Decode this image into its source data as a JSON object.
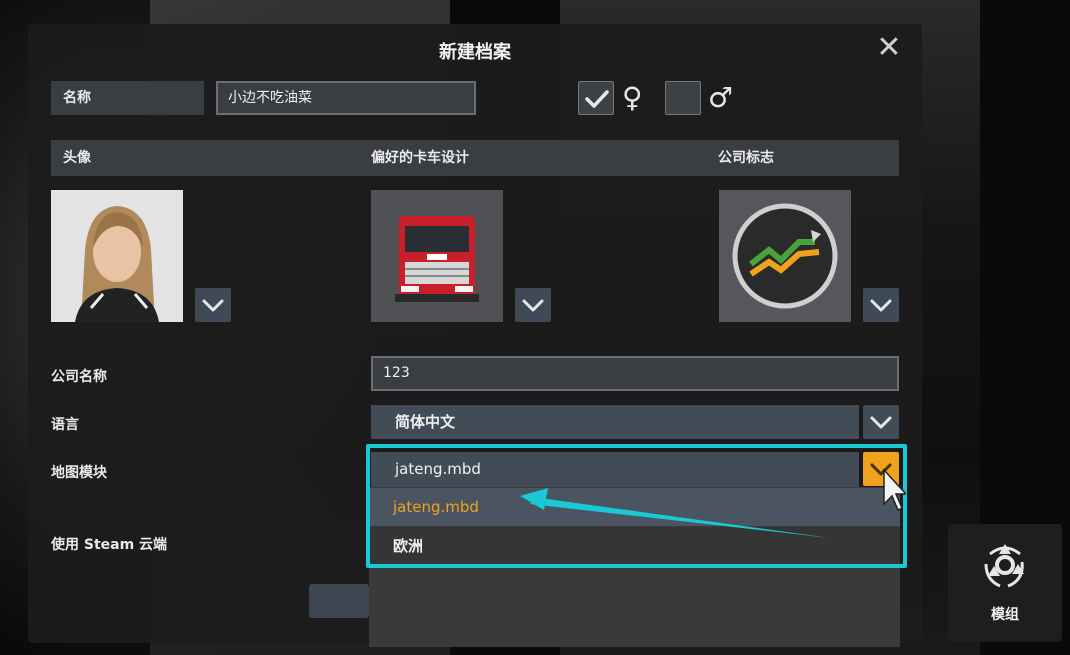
{
  "dialog": {
    "title": "新建档案",
    "close_symbol": "✕"
  },
  "name_row": {
    "label": "名称",
    "value": "小边不吃油菜",
    "female_checked": true,
    "male_checked": false,
    "female_icon": "female-sign-icon",
    "male_icon": "male-sign-icon"
  },
  "sections": {
    "avatar": "头像",
    "truck_design": "偏好的卡车设计",
    "company_logo": "公司标志"
  },
  "company": {
    "label": "公司名称",
    "value": "123"
  },
  "language": {
    "label": "语言",
    "value": "简体中文"
  },
  "map_module": {
    "label": "地图模块",
    "value": "jateng.mbd",
    "options": [
      "jateng.mbd",
      "欧洲"
    ]
  },
  "steam_cloud": {
    "label": "使用 Steam 云端"
  },
  "mods": {
    "label": "模组"
  },
  "colors": {
    "accent_orange": "#f0a21e",
    "highlight_cyan": "#19c9d3",
    "select_bg": "#414c57"
  }
}
